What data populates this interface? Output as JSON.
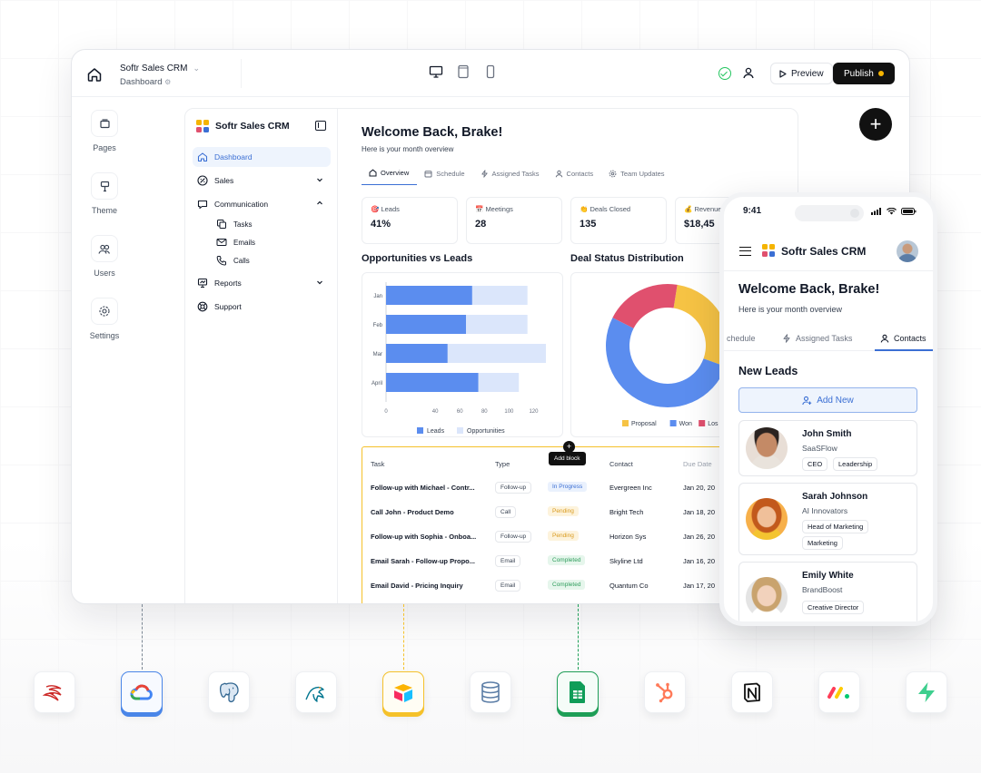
{
  "builder": {
    "app_name": "Softr Sales CRM",
    "page_name": "Dashboard",
    "preview_label": "Preview",
    "publish_label": "Publish",
    "rail": [
      {
        "label": "Pages",
        "icon": "pages-icon"
      },
      {
        "label": "Theme",
        "icon": "theme-icon"
      },
      {
        "label": "Users",
        "icon": "users-icon"
      },
      {
        "label": "Settings",
        "icon": "gear-icon"
      }
    ],
    "add_label": "+"
  },
  "app": {
    "brand": "Softr Sales CRM",
    "sidebar": {
      "items": [
        {
          "label": "Dashboard",
          "icon": "home-icon",
          "active": true
        },
        {
          "label": "Sales",
          "icon": "sales-icon"
        },
        {
          "label": "Communication",
          "icon": "chat-icon"
        },
        {
          "label": "Reports",
          "icon": "presentation-icon"
        },
        {
          "label": "Support",
          "icon": "lifebuoy-icon"
        }
      ],
      "sub_items": [
        {
          "label": "Tasks",
          "icon": "tasks-icon"
        },
        {
          "label": "Emails",
          "icon": "mail-icon"
        },
        {
          "label": "Calls",
          "icon": "phone-icon"
        }
      ]
    },
    "welcome": "Welcome Back, Brake!",
    "subtitle": "Here is your month overview",
    "tabs": [
      {
        "label": "Overview",
        "icon": "home-icon",
        "active": true
      },
      {
        "label": "Schedule",
        "icon": "calendar-icon"
      },
      {
        "label": "Assigned Tasks",
        "icon": "bolt-icon"
      },
      {
        "label": "Contacts",
        "icon": "user-icon"
      },
      {
        "label": "Team Updates",
        "icon": "gear-icon"
      }
    ],
    "stats": [
      {
        "label": "Leads",
        "value": "41%",
        "emoji": "🎯"
      },
      {
        "label": "Meetings",
        "value": "28",
        "emoji": "📅"
      },
      {
        "label": "Deals Closed",
        "value": "135",
        "emoji": "👏"
      },
      {
        "label": "Revenue",
        "value": "$18,45",
        "emoji": "💰"
      }
    ],
    "table": {
      "add_block": "Add block",
      "headers": [
        "Task",
        "Type",
        "Status",
        "Contact",
        "Due Date"
      ],
      "rows": [
        {
          "task": "Follow-up with Michael - Contr...",
          "type": "Follow-up",
          "status": "In Progress",
          "contact": "Evergreen Inc",
          "due": "Jan 20, 20"
        },
        {
          "task": "Call John - Product Demo",
          "type": "Call",
          "status": "Pending",
          "contact": "Bright Tech",
          "due": "Jan 18, 20"
        },
        {
          "task": "Follow-up with Sophia - Onboa...",
          "type": "Follow-up",
          "status": "Pending",
          "contact": "Horizon Sys",
          "due": "Jan 26, 20"
        },
        {
          "task": "Email Sarah - Follow-up Propo...",
          "type": "Email",
          "status": "Completed",
          "contact": "Skyline Ltd",
          "due": "Jan 16, 20"
        },
        {
          "task": "Email David - Pricing Inquiry",
          "type": "Email",
          "status": "Completed",
          "contact": "Quantum Co",
          "due": "Jan 17, 20"
        }
      ]
    }
  },
  "chart_data": [
    {
      "type": "bar",
      "orientation": "horizontal",
      "title": "Opportunities vs Leads",
      "categories": [
        "Jan",
        "Feb",
        "Mar",
        "April"
      ],
      "series": [
        {
          "name": "Leads",
          "values": [
            70,
            65,
            50,
            75
          ],
          "color": "#5b8def"
        },
        {
          "name": "Opportunities",
          "values": [
            115,
            115,
            130,
            108
          ],
          "color": "#dbe6fb"
        }
      ],
      "xlim": [
        0,
        130
      ],
      "xticks": [
        0,
        40,
        60,
        80,
        100,
        120
      ],
      "legend": "bottom"
    },
    {
      "type": "pie",
      "donut": true,
      "title": "Deal Status Distribution",
      "slices": [
        {
          "label": "Proposal",
          "value": 28,
          "color": "#f6c344"
        },
        {
          "label": "Won",
          "value": 52,
          "color": "#5b8def"
        },
        {
          "label": "Lost",
          "value": 20,
          "color": "#e0506e"
        }
      ],
      "legend_labels": [
        "Proposal",
        "Won",
        "Los"
      ],
      "legend": "bottom"
    }
  ],
  "phone": {
    "time": "9:41",
    "brand": "Softr Sales CRM",
    "welcome": "Welcome Back, Brake!",
    "subtitle": "Here is your month overview",
    "tabs": [
      "chedule",
      "Assigned Tasks",
      "Contacts"
    ],
    "section_title": "New Leads",
    "add_new": "Add New",
    "leads": [
      {
        "name": "John Smith",
        "company": "SaaSFlow",
        "tags": [
          "CEO",
          "Leadership"
        ]
      },
      {
        "name": "Sarah Johnson",
        "company": "AI Innovators",
        "tags": [
          "Head of Marketing",
          "Marketing"
        ]
      },
      {
        "name": "Emily White",
        "company": "BrandBoost",
        "tags": [
          "Creative Director"
        ]
      }
    ]
  },
  "integrations": [
    {
      "icon": "sql-server-icon"
    },
    {
      "icon": "google-cloud-icon",
      "highlight": "blue"
    },
    {
      "icon": "postgresql-icon"
    },
    {
      "icon": "mysql-icon"
    },
    {
      "icon": "airtable-icon",
      "highlight": "yellow"
    },
    {
      "icon": "database-icon"
    },
    {
      "icon": "google-sheets-icon",
      "highlight": "green"
    },
    {
      "icon": "hubspot-icon"
    },
    {
      "icon": "notion-icon"
    },
    {
      "icon": "monday-icon"
    },
    {
      "icon": "supabase-icon"
    }
  ]
}
